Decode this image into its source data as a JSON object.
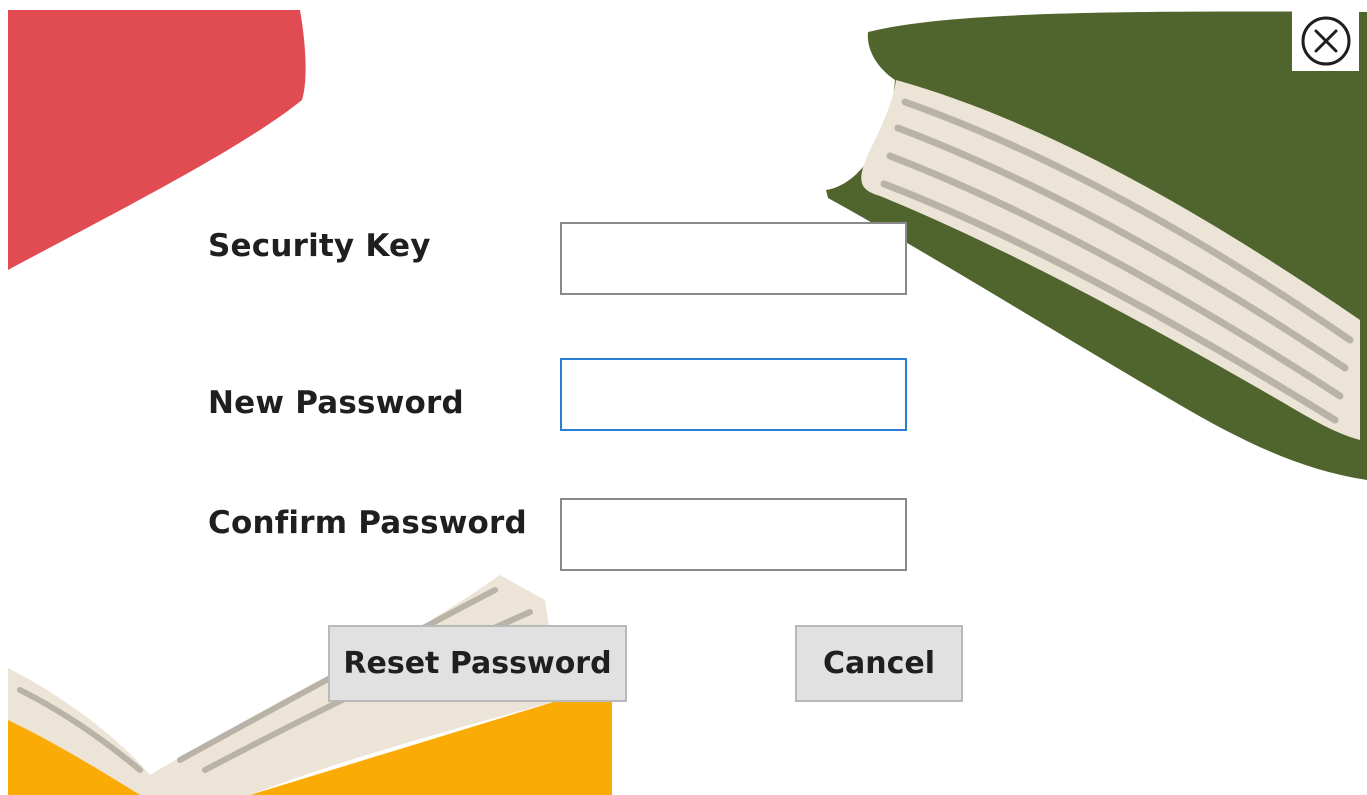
{
  "window": {
    "close_icon": "close-circle-icon"
  },
  "form": {
    "fields": [
      {
        "label": "Security Key",
        "value": "",
        "focused": false
      },
      {
        "label": "New Password",
        "value": "",
        "focused": true
      },
      {
        "label": "Confirm Password",
        "value": "",
        "focused": false
      }
    ]
  },
  "buttons": {
    "reset_label": "Reset Password",
    "cancel_label": "Cancel"
  },
  "decor": {
    "icons": [
      "red-book-icon",
      "green-book-icon",
      "open-yellow-book-icon"
    ],
    "colors": {
      "red_book": "#e14b52",
      "green_book": "#50652d",
      "pages": "#ece4d6",
      "yellow_book": "#fbab05",
      "focus_border": "#2a7fd4",
      "button_face": "#e1e1e1"
    }
  }
}
